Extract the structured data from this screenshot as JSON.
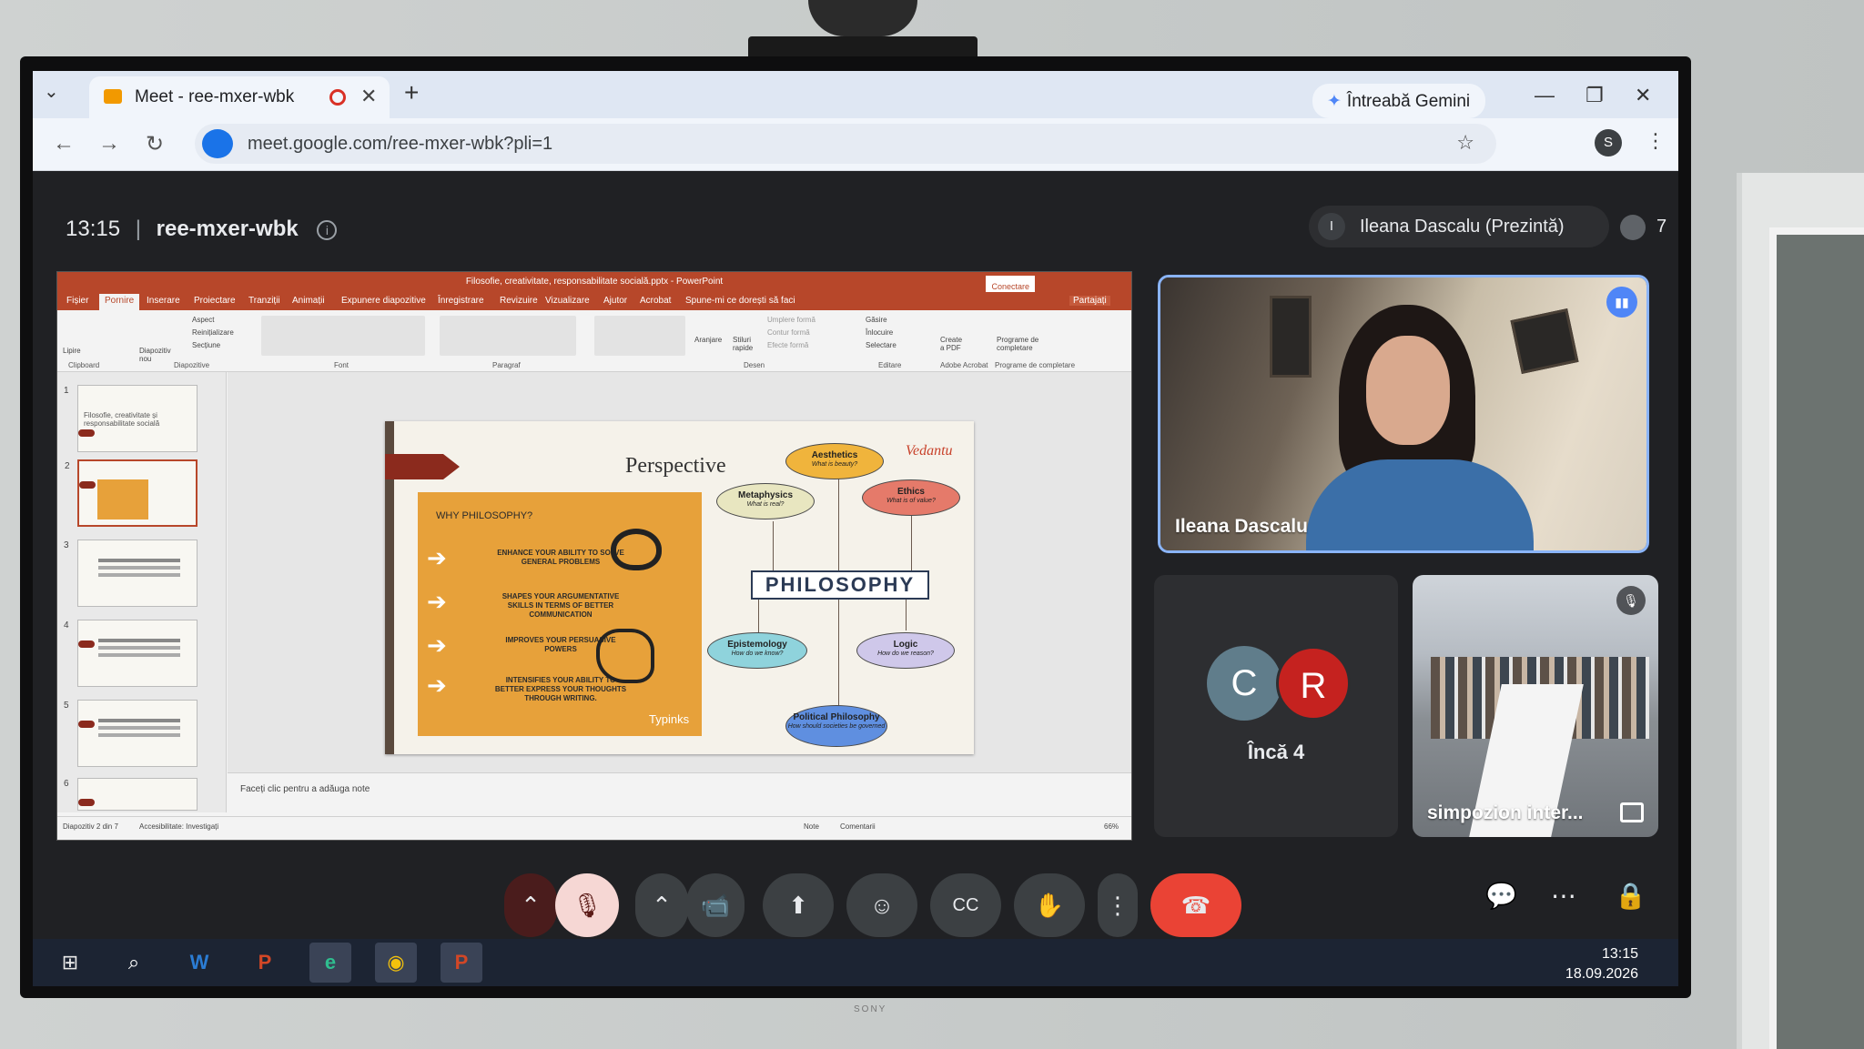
{
  "browser": {
    "tab_title": "Meet - ree-mxer-wbk",
    "tab_close": "✕",
    "new_tab": "+",
    "tab_list": "⌄",
    "gemini_label": "Întreabă Gemini",
    "url": "meet.google.com/ree-mxer-wbk?pli=1",
    "profile_initial": "S",
    "minimize": "—",
    "restore": "❐",
    "close": "✕"
  },
  "meet": {
    "time": "13:15",
    "separator": "|",
    "code": "ree-mxer-wbk",
    "presenter_initial": "I",
    "presenter_label": "Ileana Dascalu (Prezintă)",
    "participant_count": "7"
  },
  "powerpoint": {
    "window_title": "Filosofie, creativitate, responsabilitate socială.pptx - PowerPoint",
    "connect_button": "Conectare",
    "share_button": "Partajați",
    "tell_me": "Spune-mi ce dorești să faci",
    "menus": [
      "Fișier",
      "Pornire",
      "Inserare",
      "Proiectare",
      "Tranziții",
      "Animații",
      "Expunere diapozitive",
      "Înregistrare",
      "Revizuire",
      "Vizualizare",
      "Ajutor",
      "Acrobat"
    ],
    "groups": [
      "Clipboard",
      "Diapozitive",
      "Font",
      "Paragraf",
      "Desen",
      "Editare",
      "Adobe Acrobat",
      "Programe de completare"
    ],
    "ribbon_labels": {
      "paste": "Lipire",
      "new_slide": "Diapozitiv nou",
      "layout": "Aspect",
      "reset": "Reinițializare",
      "section": "Secțiune",
      "arrange": "Aranjare",
      "styles": "Stiluri rapide",
      "fill": "Umplere formă",
      "outline": "Contur formă",
      "effects": "Efecte formă",
      "find": "Găsire",
      "replace": "Înlocuire",
      "select": "Selectare",
      "create_pdf": "Create a PDF",
      "addins": "Programe de completare"
    },
    "thumb_numbers": [
      "1",
      "2",
      "3",
      "4",
      "5",
      "6"
    ],
    "thumb1_title": "Filosofie, creativitate și responsabilitate socială",
    "notes_placeholder": "Faceți clic pentru a adăuga note",
    "status_slide": "Diapozitiv 2 din 7",
    "status_accessibility": "Accesibilitate: Investigați",
    "status_notes": "Note",
    "status_comments": "Comentarii",
    "zoom": "66%"
  },
  "slide": {
    "heading": "Perspective",
    "why": "WHY PHILOSOPHY?",
    "points": [
      "ENHANCE YOUR ABILITY TO SOLVE GENERAL PROBLEMS",
      "SHAPES YOUR ARGUMENTATIVE SKILLS IN TERMS OF BETTER COMMUNICATION",
      "IMPROVES YOUR PERSUASIVE POWERS",
      "INTENSIFIES YOUR ABILITY TO BETTER EXPRESS YOUR THOUGHTS THROUGH WRITING."
    ],
    "arrow": "➔",
    "typinks": "Typinks",
    "vedantu": "Vedantu",
    "center": "PHILOSOPHY",
    "branches": [
      {
        "name": "Aesthetics",
        "q": "What is beauty?",
        "color": "#f0b43c"
      },
      {
        "name": "Metaphysics",
        "q": "What is real?",
        "color": "#e8e6c0"
      },
      {
        "name": "Ethics",
        "q": "What is of value?",
        "color": "#e57a6a"
      },
      {
        "name": "Epistemology",
        "q": "How do we know?",
        "color": "#8fd3dc"
      },
      {
        "name": "Logic",
        "q": "How do we reason?",
        "color": "#cfc8ea"
      },
      {
        "name": "Political Philosophy",
        "q": "How should societies be governed",
        "color": "#5f8fe0"
      }
    ]
  },
  "tiles": {
    "speaker_name": "Ileana Dascalu",
    "speaking_icon": "▮▮",
    "others_initials": [
      "C",
      "R"
    ],
    "others_label": "Încă 4",
    "room_name": "simpozion inter...",
    "mute_icon": "🎙"
  },
  "controls": {
    "more_chevron": "⌃",
    "mic_icon": "🎙",
    "cam_chevron": "⌃",
    "camera_icon": "📹",
    "present_icon": "⬆",
    "emoji_icon": "☺",
    "captions_icon": "CC",
    "hand_icon": "✋",
    "more_icon": "⋮",
    "hangup_icon": "☎",
    "chat_icon": "💬",
    "activities_icon": "⋯",
    "host_icon": "🔒"
  },
  "taskbar": {
    "start_icon": "⊞",
    "search_icon": "⌕",
    "word_icon": "W",
    "ppt_icon": "P",
    "edge_icon": "e",
    "chrome_icon": "◉",
    "ppt2_icon": "P",
    "time": "13:15",
    "date": "18.09.2026"
  },
  "tv_brand": "SONY",
  "colors": {
    "ppt_accent": "#b7472a",
    "meet_bg": "#202124",
    "hangup": "#ea4335",
    "active_speaker_border": "#8ab4f8"
  }
}
